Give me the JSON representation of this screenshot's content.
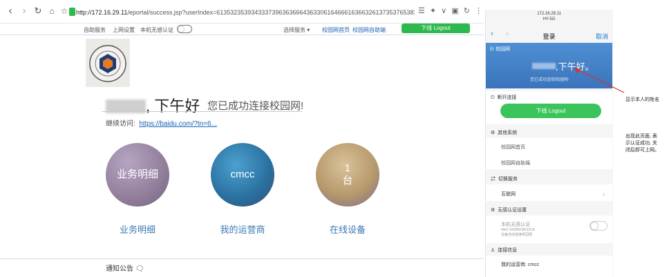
{
  "browser": {
    "url_host": "http://172.16.29.11",
    "url_path": "/eportal/success.jsp?userIndex=61353235393433373963636664363306164666163663261373537653833343053f31302e3",
    "toolbar_icons": "☰ ✦ ∨ ▣ ↻ ⋮"
  },
  "topbar": {
    "link1": "自助服务",
    "link2": "上网设置",
    "link3": "本机无感认证",
    "service": "选择服务",
    "link4": "校园网首页",
    "link5": "校园网自助端",
    "logout": "下线 Logout"
  },
  "main": {
    "greeting": ", 下午好",
    "success": "您已成功连接校园网!",
    "continue_label": "继续访问:",
    "continue_link": "https://baidu.com/?tn=6...",
    "circles": [
      {
        "text": "业务明细",
        "label": "业务明细"
      },
      {
        "text": "cmcc",
        "label": "我的运营商"
      },
      {
        "text1": "1",
        "text2": "台",
        "label": "在线设备"
      }
    ],
    "notice": "通知公告"
  },
  "phone": {
    "status_ip": "172.16.29.11",
    "status_ssid": "HY-5G",
    "title": "登录",
    "cancel": "取消",
    "banner_label": "校园网",
    "hello": ",下午好。",
    "banner_sub": "您已成功连接校园网!",
    "sec_disconnect": "断开连接",
    "logout": "下线 Logout",
    "sec_other": "其他系统",
    "other1": "校园网首页",
    "other2": "校园网自助端",
    "sec_switch": "切换服务",
    "switch_item": "互联网",
    "sec_noauth": "无感认证设置",
    "noauth_title": "本机无感认证",
    "noauth_mac": "MAC:542B5D9F32CE",
    "noauth_desc": "设备自动连接校园网",
    "sec_info": "连接信息",
    "operator": "我的运营商: cmcc"
  },
  "annotations": {
    "name_note": "显示本人的姓名",
    "success_note1": "出现此页面, 表",
    "success_note2": "示认证成功, 关",
    "success_note3": "闭后即可上网。"
  },
  "colors": {
    "accent_green": "#2db94d",
    "link_blue": "#1a5fb4",
    "arrow_red": "#e0302a"
  }
}
